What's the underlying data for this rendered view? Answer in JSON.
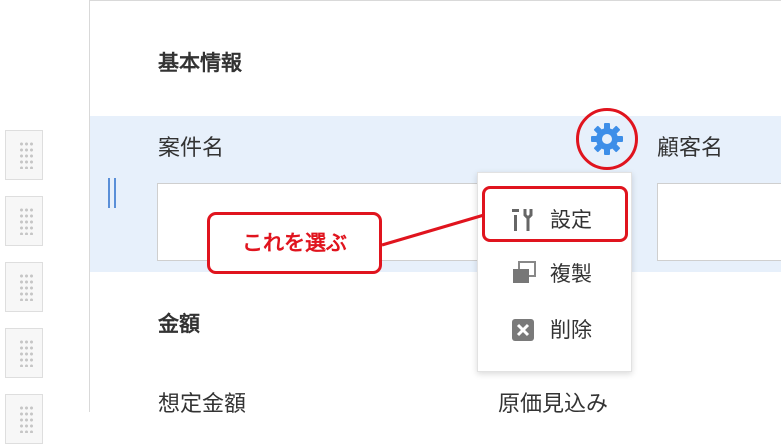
{
  "sections": {
    "basic_info": "基本情報",
    "amount": "金額"
  },
  "fields": {
    "project_name": "案件名",
    "customer_name": "顧客名",
    "expected_amount": "想定金額",
    "cost_estimate": "原価見込み"
  },
  "menu": {
    "items": [
      {
        "label": "設定",
        "icon": "tools-icon"
      },
      {
        "label": "複製",
        "icon": "duplicate-icon"
      },
      {
        "label": "削除",
        "icon": "delete-icon"
      }
    ]
  },
  "annotation": {
    "callout": "これを選ぶ"
  },
  "colors": {
    "accent": "#e0141e",
    "gear": "#3d8ee8",
    "row_highlight": "#e7f0fb"
  }
}
